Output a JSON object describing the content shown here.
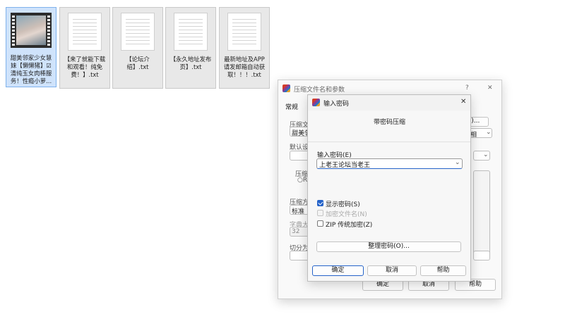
{
  "files": [
    {
      "name": "甜美邻家少女慧妹【懒懒猪】☑清纯玉女肉棒服务！性瘾小萝...",
      "type": "video",
      "selected": true
    },
    {
      "name": "【来了就能下载和观看！纯免费！】.txt",
      "type": "txt"
    },
    {
      "name": "【论坛介绍】.txt",
      "type": "txt"
    },
    {
      "name": "【永久地址发布页】.txt",
      "type": "txt"
    },
    {
      "name": "最新地址及APP请发邮箱自动获取！！！.txt",
      "type": "txt"
    }
  ],
  "back_dialog": {
    "title": "压缩文件名和参数",
    "help_glyph": "?",
    "close_glyph": "✕",
    "tab_general": "常规",
    "archive_name_label": "压缩文",
    "archive_name_value": "甜美邻",
    "browse_button": "(B)...",
    "update_mode_value": "为相",
    "default_profile_label": "默认设",
    "archive_format_label": "压缩文",
    "format_radio_partial": "R",
    "method_label": "压缩方",
    "method_value": "标准",
    "dict_label": "字典大",
    "dict_value": "32",
    "split_label": "切分为",
    "ok": "确定",
    "cancel": "取消",
    "help": "帮助"
  },
  "password_dialog": {
    "title": "输入密码",
    "close_glyph": "✕",
    "heading": "带密码压缩",
    "enter_password_label": "输入密码(E)",
    "password_value": "上老王论坛当老王",
    "show_password_label": "显示密码(S)",
    "show_password_checked": true,
    "encrypt_names_label": "加密文件名(N)",
    "encrypt_names_checked": false,
    "zip_legacy_label": "ZIP 传统加密(Z)",
    "zip_legacy_checked": false,
    "organize_button": "整理密码(O)...",
    "ok": "确定",
    "cancel": "取消",
    "help": "帮助"
  },
  "colors": {
    "accent": "#2563c9",
    "selection": "#cfe3fb"
  }
}
